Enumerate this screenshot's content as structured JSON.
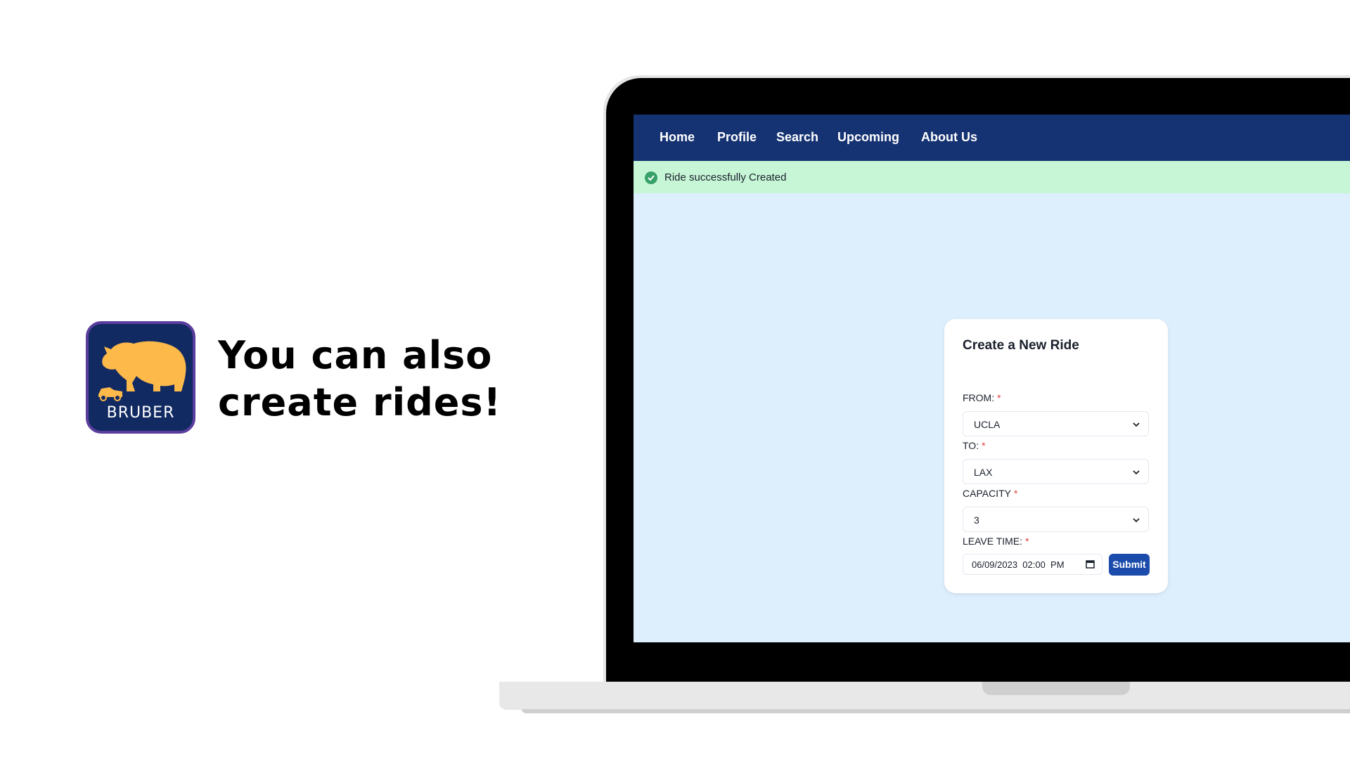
{
  "brand": {
    "name": "BRUBER"
  },
  "headline": {
    "line1": "You can also",
    "line2": "create rides!"
  },
  "nav": {
    "items": [
      "Home",
      "Profile",
      "Search",
      "Upcoming",
      "About Us"
    ]
  },
  "alert": {
    "message": "Ride successfully Created",
    "status": "success"
  },
  "form": {
    "title": "Create a New Ride",
    "from": {
      "label": "FROM:",
      "value": "UCLA",
      "required_mark": "*"
    },
    "to": {
      "label": "TO:",
      "value": "LAX",
      "required_mark": "*"
    },
    "capacity": {
      "label": "CAPACITY",
      "value": "3",
      "required_mark": "*"
    },
    "leave_time": {
      "label": "LEAVE TIME:",
      "value": "06/09/2023  02:00  PM",
      "required_mark": "*"
    },
    "submit_label": "Submit"
  },
  "colors": {
    "navbar": "#153372",
    "alert_bg": "#c6f6d5",
    "screen_bg": "#ddeefc",
    "submit": "#1c4cab",
    "logo_bg": "#112a62",
    "bear": "#fdb94a"
  },
  "icons": [
    "bear-logo-icon",
    "car-icon",
    "check-circle-icon",
    "chevron-down-icon",
    "calendar-icon"
  ]
}
